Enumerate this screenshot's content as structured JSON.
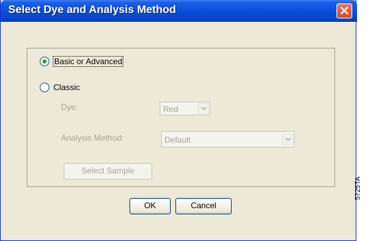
{
  "window": {
    "title": "Select Dye and Analysis Method"
  },
  "options": {
    "basic_label": "Basic or Advanced",
    "classic_label": "Classic",
    "basic_selected": true
  },
  "classic": {
    "dye_label": "Dye:",
    "dye_value": "Red",
    "method_label": "Analysis Method:",
    "method_value": "Default",
    "select_sample_label": "Select Sample"
  },
  "buttons": {
    "ok_label": "OK",
    "cancel_label": "Cancel"
  },
  "figure_code": "5725TA",
  "icons": {
    "close": "close-icon",
    "dropdown": "chevron-down-icon"
  },
  "colors": {
    "titlebar": "#0a4fd8",
    "dialog_bg": "#ece9d8",
    "close": "#d34a2b",
    "radio_dot": "#21a121"
  }
}
